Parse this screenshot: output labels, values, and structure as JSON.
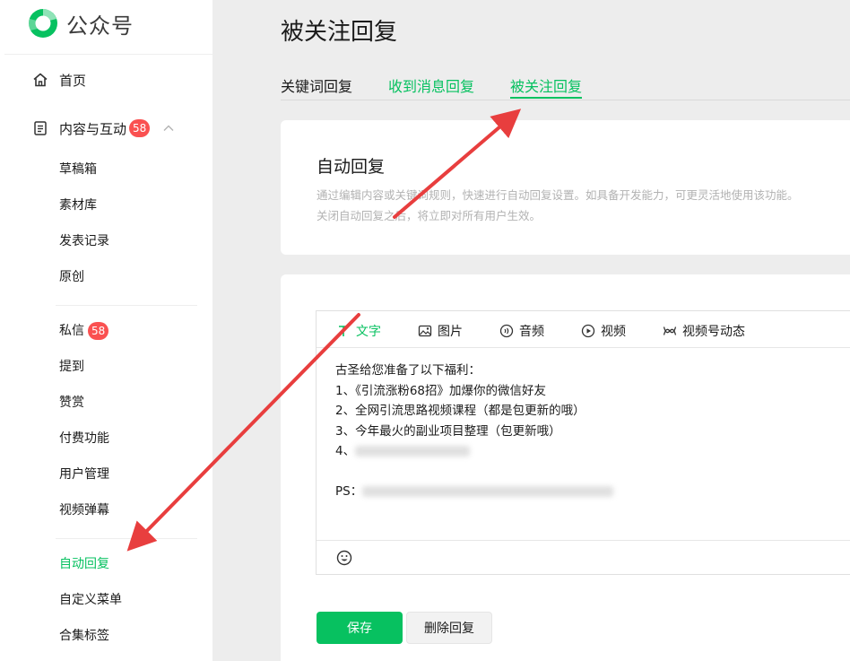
{
  "brand": {
    "name": "公众号",
    "accent": "#07c160",
    "badge_color": "#fa5151"
  },
  "sidebar": {
    "home": {
      "label": "首页",
      "icon": "home-icon"
    },
    "content": {
      "label": "内容与互动",
      "badge": "58",
      "icon": "document-icon"
    },
    "content_items": [
      {
        "label": "草稿箱"
      },
      {
        "label": "素材库"
      },
      {
        "label": "发表记录"
      },
      {
        "label": "原创"
      }
    ],
    "interaction_items": [
      {
        "label": "私信",
        "badge": "58"
      },
      {
        "label": "提到"
      },
      {
        "label": "赞赏"
      },
      {
        "label": "付费功能"
      },
      {
        "label": "用户管理"
      },
      {
        "label": "视频弹幕"
      }
    ],
    "reply_items": [
      {
        "label": "自动回复",
        "active": true
      },
      {
        "label": "自定义菜单"
      },
      {
        "label": "合集标签"
      }
    ]
  },
  "main": {
    "title": "被关注回复",
    "tabs": [
      {
        "label": "关键词回复"
      },
      {
        "label": "收到消息回复"
      },
      {
        "label": "被关注回复",
        "active": true
      }
    ],
    "intro": {
      "title": "自动回复",
      "desc_line1": "通过编辑内容或关键词规则，快速进行自动回复设置。如具备开发能力，可更灵活地使用该功能。",
      "desc_line2": "关闭自动回复之后，将立即对所有用户生效。"
    },
    "editor": {
      "tools": [
        {
          "label": "文字",
          "icon": "text-icon"
        },
        {
          "label": "图片",
          "icon": "image-icon"
        },
        {
          "label": "音频",
          "icon": "audio-icon"
        },
        {
          "label": "视频",
          "icon": "video-icon"
        },
        {
          "label": "视频号动态",
          "icon": "channels-icon"
        }
      ],
      "lines": [
        "古圣给您准备了以下福利：",
        "1、《引流涨粉68招》加爆你的微信好友",
        "2、全网引流思路视频课程（都是包更新的哦）",
        "3、今年最火的副业项目整理（包更新哦）"
      ],
      "line4_prefix": "4、",
      "ps_prefix": "PS："
    },
    "buttons": {
      "save": "保存",
      "delete": "删除回复"
    }
  }
}
